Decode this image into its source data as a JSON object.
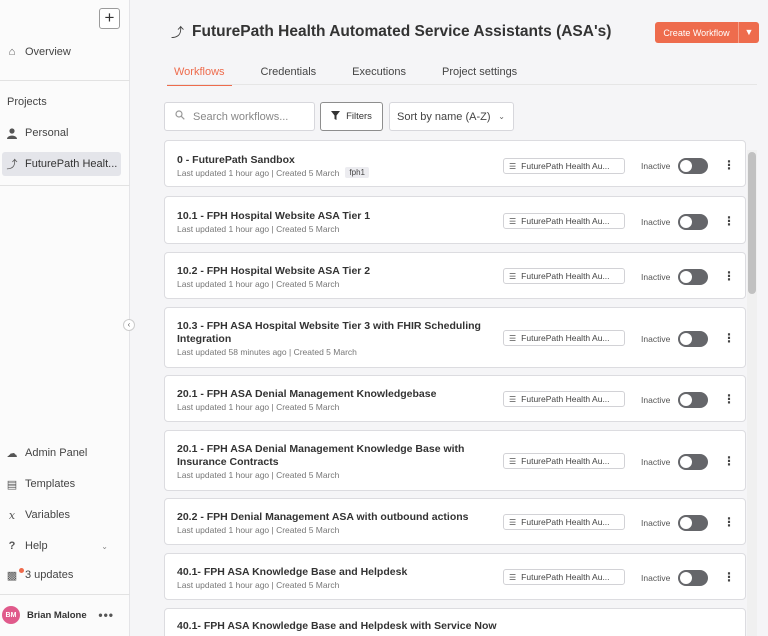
{
  "sidebar": {
    "overview": "Overview",
    "projects_heading": "Projects",
    "personal": "Personal",
    "project_active": "FuturePath Healt...",
    "admin_panel": "Admin Panel",
    "templates": "Templates",
    "variables": "Variables",
    "help": "Help",
    "updates": "3 updates",
    "user_initials": "BM",
    "user_name": "Brian Malone"
  },
  "header": {
    "title": "FuturePath Health Automated Service Assistants (ASA's)",
    "create_button": "Create Workflow"
  },
  "tabs": [
    {
      "label": "Workflows",
      "active": true
    },
    {
      "label": "Credentials",
      "active": false
    },
    {
      "label": "Executions",
      "active": false
    },
    {
      "label": "Project settings",
      "active": false
    }
  ],
  "toolbar": {
    "search_placeholder": "Search workflows...",
    "filters_label": "Filters",
    "sort_label": "Sort by name (A-Z)"
  },
  "workflows": [
    {
      "name": "0 - FuturePath Sandbox",
      "meta": "Last updated 1 hour ago | Created 5 March",
      "tag": "fph1",
      "project": "FuturePath Health Au...",
      "status": "Inactive"
    },
    {
      "name": "10.1 - FPH Hospital Website ASA Tier 1",
      "meta": "Last updated 1 hour ago | Created 5 March",
      "project": "FuturePath Health Au...",
      "status": "Inactive"
    },
    {
      "name": "10.2 - FPH Hospital Website ASA Tier 2",
      "meta": "Last updated 1 hour ago | Created 5 March",
      "project": "FuturePath Health Au...",
      "status": "Inactive"
    },
    {
      "name": "10.3 - FPH ASA Hospital Website Tier 3 with FHIR Scheduling Integration",
      "meta": "Last updated 58 minutes ago | Created 5 March",
      "project": "FuturePath Health Au...",
      "status": "Inactive"
    },
    {
      "name": "20.1 - FPH ASA Denial Management Knowledgebase",
      "meta": "Last updated 1 hour ago | Created 5 March",
      "project": "FuturePath Health Au...",
      "status": "Inactive"
    },
    {
      "name": "20.1 - FPH ASA Denial Management Knowledge Base with Insurance Contracts",
      "meta": "Last updated 1 hour ago | Created 5 March",
      "project": "FuturePath Health Au...",
      "status": "Inactive"
    },
    {
      "name": "20.2 - FPH Denial Management ASA with outbound actions",
      "meta": "Last updated 1 hour ago | Created 5 March",
      "project": "FuturePath Health Au...",
      "status": "Inactive"
    },
    {
      "name": "40.1- FPH ASA Knowledge Base and Helpdesk",
      "meta": "Last updated 1 hour ago | Created 5 March",
      "project": "FuturePath Health Au...",
      "status": "Inactive"
    },
    {
      "name": "40.1- FPH ASA Knowledge Base and Helpdesk with Service Now",
      "meta": "",
      "project": "",
      "status": ""
    }
  ]
}
